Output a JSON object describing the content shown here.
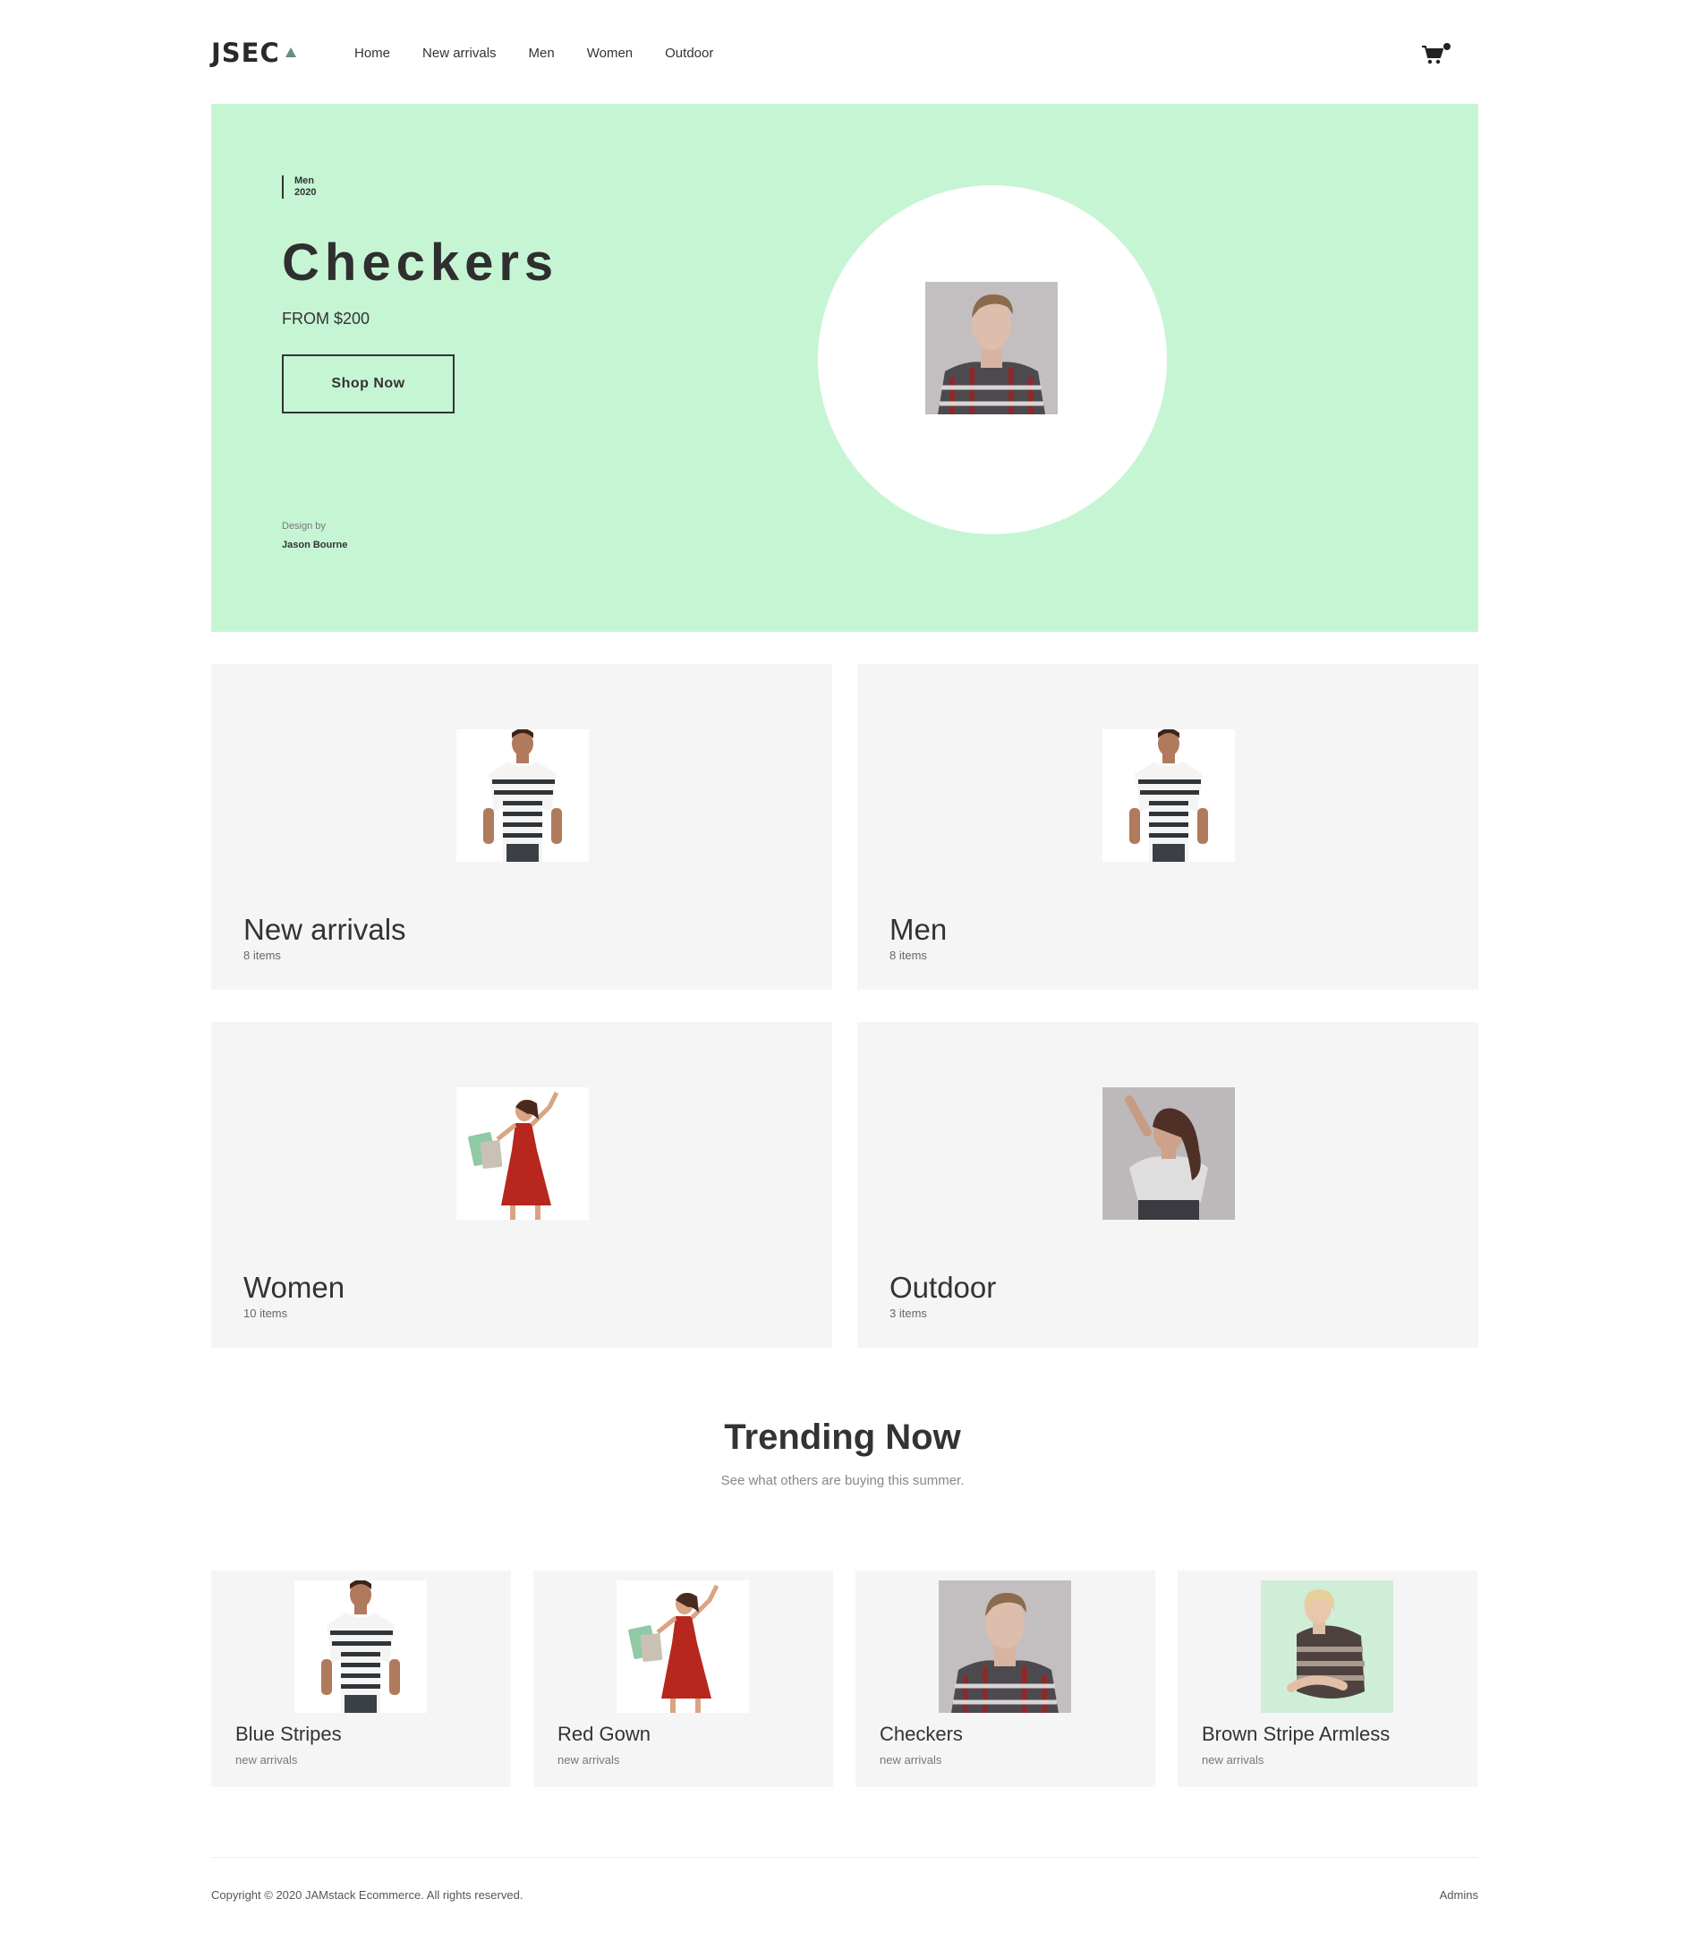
{
  "header": {
    "logo": "JSEC",
    "nav": [
      "Home",
      "New arrivals",
      "Men",
      "Women",
      "Outdoor"
    ],
    "cart_icon": "cart-icon"
  },
  "hero": {
    "category": "Men",
    "year": "2020",
    "title": "Checkers",
    "price": "FROM $200",
    "button": "Shop Now",
    "design_label": "Design by",
    "designer": "Jason Bourne",
    "background": "#c6f5d4"
  },
  "categories": [
    {
      "name": "New arrivals",
      "count": "8 items"
    },
    {
      "name": "Men",
      "count": "8 items"
    },
    {
      "name": "Women",
      "count": "10 items"
    },
    {
      "name": "Outdoor",
      "count": "3 items"
    }
  ],
  "trending": {
    "title": "Trending Now",
    "subtitle": "See what others are buying this summer.",
    "products": [
      {
        "name": "Blue Stripes",
        "category": "new arrivals"
      },
      {
        "name": "Red Gown",
        "category": "new arrivals"
      },
      {
        "name": "Checkers",
        "category": "new arrivals"
      },
      {
        "name": "Brown Stripe Armless",
        "category": "new arrivals"
      }
    ]
  },
  "footer": {
    "copyright": "Copyright © 2020 JAMstack Ecommerce. All rights reserved.",
    "admin_link": "Admins"
  }
}
